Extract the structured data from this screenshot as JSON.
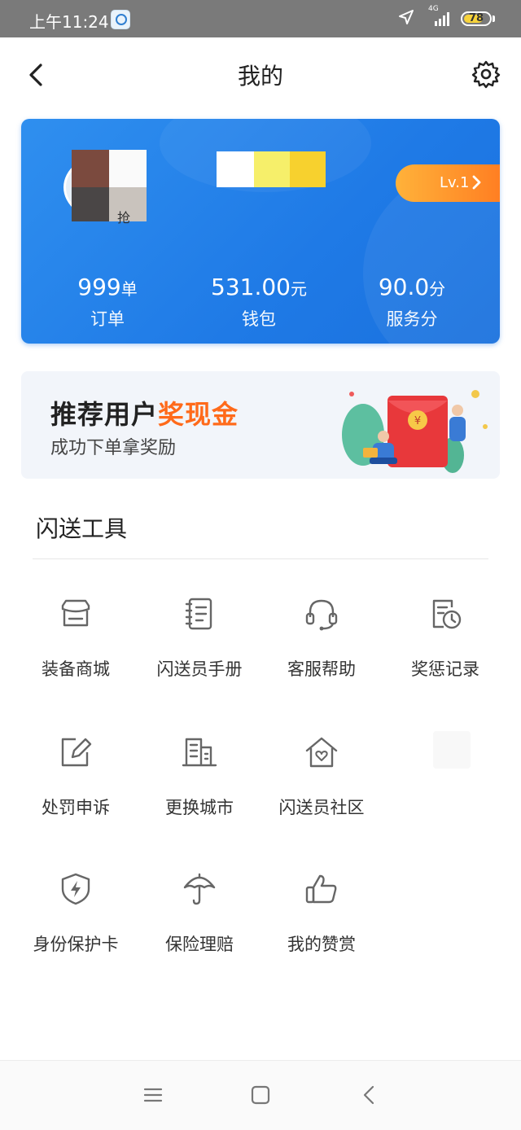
{
  "status_bar": {
    "time": "上午11:24",
    "network": "4G",
    "battery": "78",
    "battery_level": 0.78,
    "icons": [
      "app-notification-icon",
      "location-arrow-icon",
      "signal-icon",
      "battery-icon"
    ]
  },
  "header": {
    "title": "我的",
    "icons": [
      "back-arrow-icon",
      "gear-icon"
    ]
  },
  "profile": {
    "avatar_badge": "抢",
    "level": "Lv.1",
    "stats": [
      {
        "value": "999",
        "unit": "单",
        "label": "订单"
      },
      {
        "value": "531.00",
        "unit": "元",
        "label": "钱包"
      },
      {
        "value": "90.0",
        "unit": "分",
        "label": "服务分"
      }
    ],
    "colors": {
      "card": "#1f7ae6",
      "level": "#ff7a20"
    }
  },
  "promo": {
    "title_prefix": "推荐用户",
    "title_highlight": "奖现金",
    "subtitle": "成功下单拿奖励",
    "colors": {
      "highlight": "#ff6a1a",
      "background": "#f2f5fa"
    }
  },
  "tools": {
    "section_title": "闪送工具",
    "items": [
      {
        "label": "装备商城",
        "icon": "store-icon"
      },
      {
        "label": "闪送员手册",
        "icon": "notebook-icon"
      },
      {
        "label": "客服帮助",
        "icon": "headset-icon"
      },
      {
        "label": "奖惩记录",
        "icon": "clock-record-icon"
      },
      {
        "label": "处罚申诉",
        "icon": "edit-icon"
      },
      {
        "label": "更换城市",
        "icon": "buildings-icon"
      },
      {
        "label": "闪送员社区",
        "icon": "home-heart-icon"
      },
      {
        "label": "身份保护卡",
        "icon": "shield-lightning-icon"
      },
      {
        "label": "保险理赔",
        "icon": "umbrella-icon"
      },
      {
        "label": "我的赞赏",
        "icon": "thumbs-up-icon"
      }
    ]
  },
  "nav": {
    "icons": [
      "menu-icon",
      "home-square-icon",
      "back-triangle-icon"
    ]
  }
}
